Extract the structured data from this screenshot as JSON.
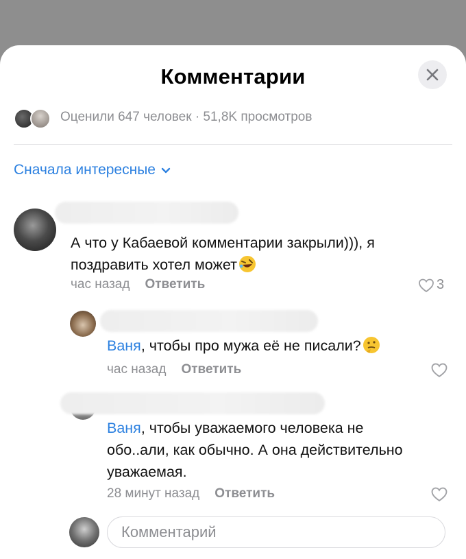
{
  "header": {
    "title": "Комментарии",
    "close_icon": "close-icon"
  },
  "stats": {
    "text": "Оценили 647 человек · 51,8K просмотров"
  },
  "sort": {
    "label": "Сначала интересные",
    "icon": "chevron-down-icon"
  },
  "comments": [
    {
      "text": "А что у Кабаевой комментарии закрыли))), я поздравить хотел может",
      "emoji": "rolling-laughing-emoji",
      "time": "час назад",
      "reply_label": "Ответить",
      "likes": "3"
    },
    {
      "mention": "Ваня",
      "text": ", чтобы про мужа её не писали?",
      "emoji": "thinking-face-emoji",
      "time": "час назад",
      "reply_label": "Ответить"
    },
    {
      "mention": "Ваня",
      "text": ", чтобы уважаемого человека не обо..али, как обычно. А она действительно уважаемая.",
      "time": "28 минут назад",
      "reply_label": "Ответить"
    }
  ],
  "composer": {
    "placeholder": "Комментарий"
  },
  "colors": {
    "accent": "#2d81e0",
    "secondary": "#8d8e92",
    "backdrop": "#8e8e8e"
  }
}
